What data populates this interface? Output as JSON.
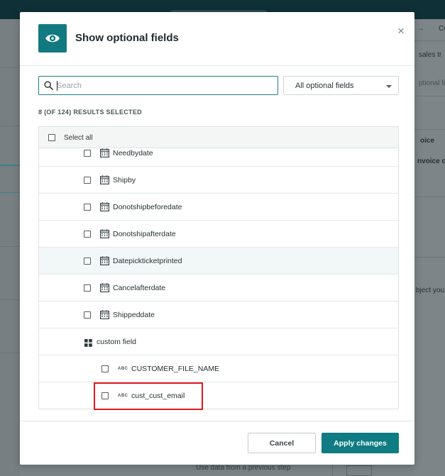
{
  "modal": {
    "title": "Show optional fields",
    "close_label": "×",
    "icon": "eye-icon"
  },
  "search": {
    "placeholder": "Search",
    "value": ""
  },
  "filter": {
    "selected": "All optional fields"
  },
  "results_count": "8 (OF 124) RESULTS SELECTED",
  "list": {
    "select_all_label": "Select all",
    "rows": [
      {
        "label": "Needbydate",
        "type": "date",
        "icon": "calendar-icon"
      },
      {
        "label": "Shipby",
        "type": "date",
        "icon": "calendar-icon"
      },
      {
        "label": "Donotshipbeforedate",
        "type": "date",
        "icon": "calendar-icon"
      },
      {
        "label": "Donotshipafterdate",
        "type": "date",
        "icon": "calendar-icon"
      },
      {
        "label": "Datepickticketprinted",
        "type": "date",
        "icon": "calendar-icon"
      },
      {
        "label": "Cancelafterdate",
        "type": "date",
        "icon": "calendar-icon"
      },
      {
        "label": "Shippeddate",
        "type": "date",
        "icon": "calendar-icon"
      }
    ],
    "group": {
      "label": "custom field",
      "icon": "grid-icon"
    },
    "group_rows": [
      {
        "label": "CUSTOMER_FILE_NAME",
        "type_tag": "ABC"
      },
      {
        "label": "cust_cust_email",
        "type_tag": "ABC"
      }
    ]
  },
  "footer": {
    "cancel_label": "Cancel",
    "apply_label": "Apply changes"
  },
  "background": {
    "right_texts": [
      "Co",
      "sales tr",
      "ptional fiel",
      "oice",
      "nvoice c",
      "bject you"
    ],
    "bottom_text": "Use data from a previous step"
  },
  "colors": {
    "accent": "#117a80",
    "highlight": "#e0191f"
  }
}
